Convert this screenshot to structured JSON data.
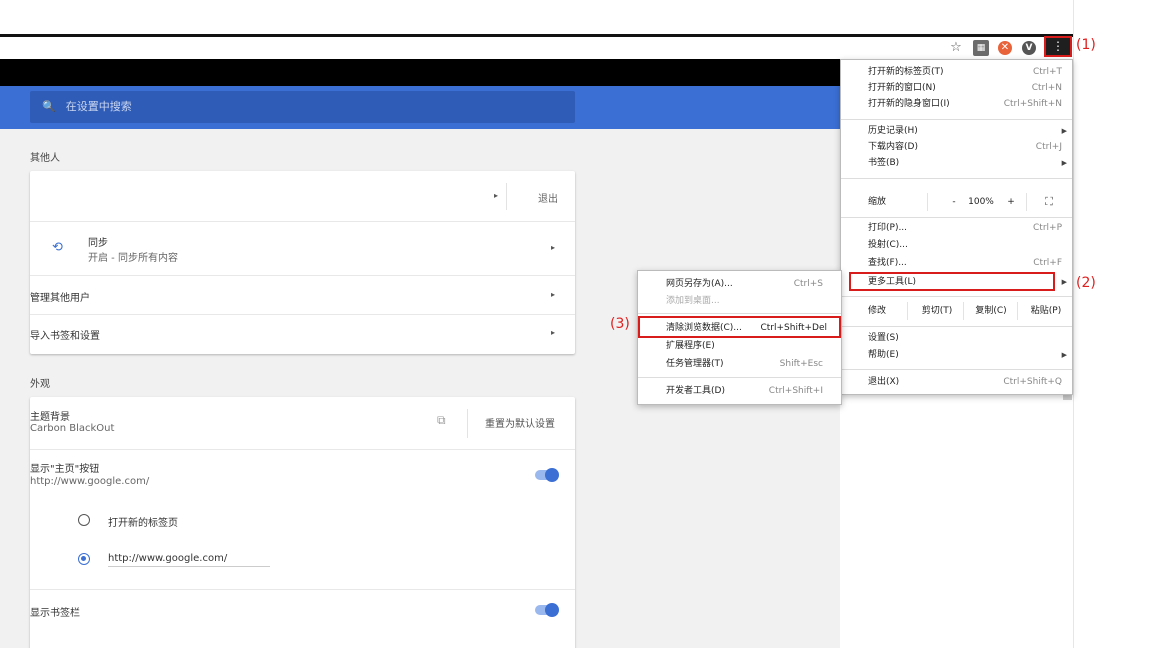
{
  "annotations": {
    "c1": "(1)",
    "c2": "(2)",
    "c3": "(3)"
  },
  "toolbar": {
    "star_icon": "☆",
    "menu_icon": "⋮"
  },
  "search": {
    "placeholder": "在设置中搜索"
  },
  "sections": {
    "people": "其他人",
    "appearance": "外观"
  },
  "people": {
    "signout": "退出",
    "sync_title": "同步",
    "sync_sub": "开启 - 同步所有内容",
    "manage_users": "管理其他用户",
    "import": "导入书签和设置"
  },
  "appearance": {
    "theme_title": "主题背景",
    "theme_sub": "Carbon BlackOut",
    "reset_theme": "重置为默认设置",
    "home_title": "显示\"主页\"按钮",
    "home_sub": "http://www.google.com/",
    "opt_newtab": "打开新的标签页",
    "opt_url": "http://www.google.com/",
    "bookmarks_bar": "显示书签栏"
  },
  "menu": {
    "new_tab": "打开新的标签页(T)",
    "new_tab_sc": "Ctrl+T",
    "new_window": "打开新的窗口(N)",
    "new_window_sc": "Ctrl+N",
    "incognito": "打开新的隐身窗口(I)",
    "incognito_sc": "Ctrl+Shift+N",
    "history": "历史记录(H)",
    "downloads": "下载内容(D)",
    "downloads_sc": "Ctrl+J",
    "bookmarks": "书签(B)",
    "zoom": "缩放",
    "zoom_minus": "-",
    "zoom_value": "100%",
    "zoom_plus": "+",
    "fullscreen": "⛶",
    "print": "打印(P)...",
    "print_sc": "Ctrl+P",
    "cast": "投射(C)...",
    "find": "查找(F)...",
    "find_sc": "Ctrl+F",
    "more_tools": "更多工具(L)",
    "edit": "修改",
    "cut": "剪切(T)",
    "copy": "复制(C)",
    "paste": "粘贴(P)",
    "settings": "设置(S)",
    "help": "帮助(E)",
    "exit": "退出(X)",
    "exit_sc": "Ctrl+Shift+Q"
  },
  "submenu": {
    "save_page": "网页另存为(A)...",
    "save_page_sc": "Ctrl+S",
    "add_desktop": "添加到桌面...",
    "clear_data": "清除浏览数据(C)...",
    "clear_data_sc": "Ctrl+Shift+Del",
    "extensions": "扩展程序(E)",
    "task_manager": "任务管理器(T)",
    "task_manager_sc": "Shift+Esc",
    "dev_tools": "开发者工具(D)",
    "dev_tools_sc": "Ctrl+Shift+I"
  }
}
